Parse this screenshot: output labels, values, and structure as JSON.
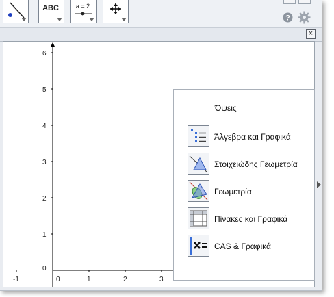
{
  "toolbar": {
    "tools": [
      {
        "name": "point-line-tool"
      },
      {
        "name": "text-tool",
        "label": "ABC"
      },
      {
        "name": "slider-tool",
        "label": "a = 2"
      },
      {
        "name": "move-graphics-tool"
      }
    ]
  },
  "icons": {
    "help": "help-icon",
    "settings": "gear-icon",
    "close": "close-icon",
    "dock": "dock-arrow-icon"
  },
  "graph": {
    "x_ticks": [
      "-1",
      "0",
      "1",
      "2",
      "3"
    ],
    "y_ticks": [
      "0",
      "1",
      "2",
      "3",
      "4",
      "5",
      "6"
    ]
  },
  "perspectives": {
    "title": "Όψεις",
    "items": [
      {
        "id": "algebra",
        "label": "Άλγεβρα και Γραφικά",
        "icon": "algebra-graphics-icon"
      },
      {
        "id": "basic",
        "label": "Στοιχειώδης Γεωμετρία",
        "icon": "basic-geometry-icon"
      },
      {
        "id": "geometry",
        "label": "Γεωμετρία",
        "icon": "geometry-icon"
      },
      {
        "id": "spreadsheet",
        "label": "Πίνακες και Γραφικά",
        "icon": "spreadsheet-icon"
      },
      {
        "id": "cas",
        "label": "CAS & Γραφικά",
        "icon": "cas-icon"
      }
    ]
  },
  "colors": {
    "toolbar_bg": "#eef1f5",
    "axis": "#000000",
    "icon_blue": "#3a6fd8"
  }
}
